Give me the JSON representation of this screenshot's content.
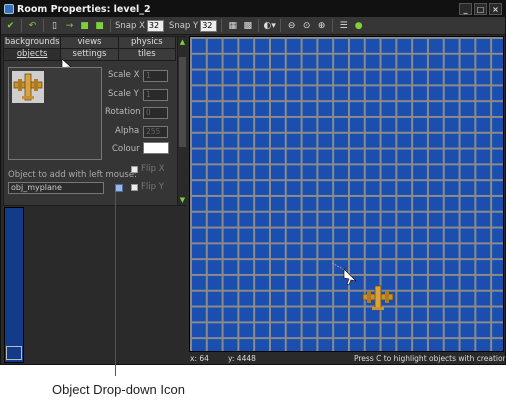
{
  "window": {
    "title": "Room Properties: level_2"
  },
  "toolbar": {
    "snap_x_label": "Snap X",
    "snap_x_value": "32",
    "snap_y_label": "Snap Y",
    "snap_y_value": "32"
  },
  "tabs": {
    "row1": [
      "backgrounds",
      "views",
      "physics"
    ],
    "row2": [
      "objects",
      "settings",
      "tiles"
    ],
    "active": "objects"
  },
  "properties": {
    "scale_x_label": "Scale X",
    "scale_x_value": "1",
    "scale_y_label": "Scale Y",
    "scale_y_value": "1",
    "rotation_label": "Rotation",
    "rotation_value": "0",
    "alpha_label": "Alpha",
    "alpha_value": "255",
    "colour_label": "Colour",
    "colour_value": "#ffffff"
  },
  "flip": {
    "flip_x_label": "Flip X",
    "flip_y_label": "Flip Y"
  },
  "object_select": {
    "label": "Object to add with left mouse:",
    "value": "obj_myplane"
  },
  "status": {
    "x": "x: 64",
    "y": "y: 4448",
    "hint": "Press C to highlight objects with creation code"
  },
  "caption": "Object Drop-down Icon",
  "colors": {
    "room_bg": "#1a4fb0",
    "grid": "#8a8a8a",
    "panel": "#353535"
  }
}
